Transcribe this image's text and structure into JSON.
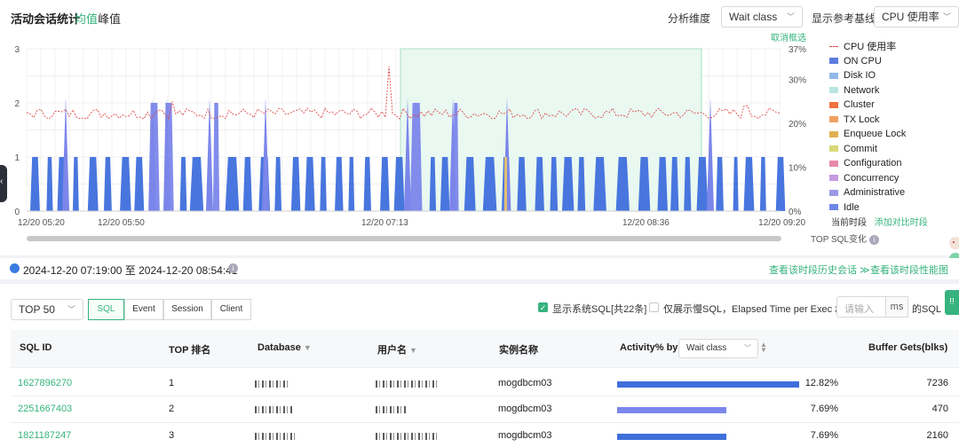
{
  "header": {
    "title": "活动会话统计",
    "tab_avg": "均值",
    "tab_peak": "峰值",
    "dimension_label": "分析维度",
    "dimension_value": "Wait class",
    "baseline_label": "显示参考基线",
    "baseline_value": "CPU 使用率",
    "cancel_selection": "取消框选"
  },
  "chart_data": {
    "type": "area",
    "y_left_ticks": [
      "3",
      "2",
      "1",
      "0"
    ],
    "y_right_ticks": [
      "37%",
      "30%",
      "20%",
      "10%",
      "0%"
    ],
    "ylim_left": [
      0,
      3
    ],
    "ylim_right": [
      0,
      37
    ],
    "x_tick_labels": [
      "12/20 05:20",
      "12/20 05:50",
      "12/20 07:13",
      "12/20 08:36",
      "12/20 09:20"
    ],
    "selected_range": [
      "12/20 07:19",
      "12/20 08:54"
    ],
    "series": [
      {
        "name": "CPU 使用率",
        "style": "dashed-line",
        "typical_value": 22,
        "peaks": [
          35,
          27,
          24
        ]
      },
      {
        "name": "ON CPU",
        "typical_value": 1,
        "peaks": [
          2,
          2,
          2,
          2,
          2,
          2,
          2
        ]
      },
      {
        "name": "Idle",
        "typical_value": 0
      }
    ],
    "legend": [
      "CPU 使用率",
      "ON CPU",
      "Disk IO",
      "Network",
      "Cluster",
      "TX Lock",
      "Enqueue Lock",
      "Commit",
      "Configuration",
      "Concurrency",
      "Administrative",
      "Idle"
    ],
    "legend_colors": [
      "#e04848",
      "#5b7be0",
      "#8fb9e8",
      "#b9e4e0",
      "#f07040",
      "#f0a060",
      "#e0b050",
      "#d8d878",
      "#e88aa8",
      "#c49ae0",
      "#9a9ae8",
      "#6f86e8"
    ],
    "legend_position": "right",
    "grid": true
  },
  "legend_footer": {
    "current_period": "当前时段",
    "add_compare": "添加对比时段",
    "top_sql_change": "TOP SQL变化"
  },
  "range_bar": {
    "time_range": "2024-12-20 07:19:00 至 2024-12-20 08:54:41",
    "history_link": "查看该时段历史会话 ≫",
    "perf_link": "查看该时段性能图"
  },
  "toolbar": {
    "top_select": "TOP 50",
    "tabs": [
      "SQL",
      "Event",
      "Session",
      "Client"
    ],
    "show_system_sql": "显示系统SQL[共22条]",
    "slow_only": "仅展示慢SQL，Elapsed Time per Exec ≥",
    "threshold_placeholder": "请输入",
    "unit": "ms",
    "suffix": "的SQL"
  },
  "table": {
    "columns": [
      "SQL ID",
      "TOP 排名",
      "Database",
      "用户名",
      "实例名称",
      "Activity% by",
      "Buffer Gets(blks)"
    ],
    "activity_by": "Wait class",
    "rows": [
      {
        "sql_id": "1627896270",
        "rank": "1",
        "instance": "mogdbcm03",
        "activity": "12.82%",
        "activity_value": 12.82,
        "buffer_gets": "7236"
      },
      {
        "sql_id": "2251667403",
        "rank": "2",
        "instance": "mogdbcm03",
        "activity": "7.69%",
        "activity_value": 7.69,
        "buffer_gets": "470"
      },
      {
        "sql_id": "1821187247",
        "rank": "3",
        "instance": "mogdbcm03",
        "activity": "7.69%",
        "activity_value": 7.69,
        "buffer_gets": "2160"
      }
    ]
  },
  "colors": {
    "accent": "#36b37e",
    "bar_primary": "#3f6fdc",
    "bar_secondary": "#7b86ea",
    "cpu_line": "#e04848"
  }
}
